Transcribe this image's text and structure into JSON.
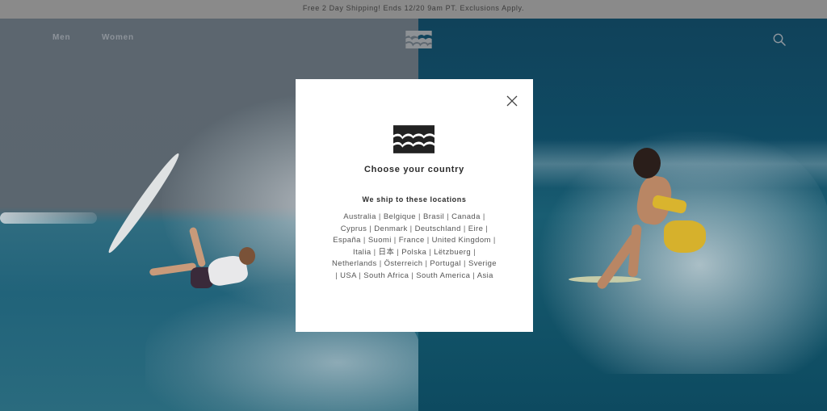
{
  "promo_bar": {
    "text": "Free 2 Day Shipping! Ends 12/20 9am PT. Exclusions Apply."
  },
  "header": {
    "nav": [
      {
        "label": "Men"
      },
      {
        "label": "Women"
      }
    ],
    "logo_icon": "billabong-wave-logo",
    "search_icon": "search-icon"
  },
  "hero": {
    "left_image": "male surfer carving wave with spray",
    "right_image": "female surfer in yellow bikini riding wave"
  },
  "modal": {
    "close_icon": "close-icon",
    "logo_icon": "billabong-wave-logo",
    "title": "Choose your country",
    "subtitle": "We ship to these locations",
    "countries": [
      "Australia",
      "Belgique",
      "Brasil",
      "Canada",
      "Cyprus",
      "Denmark",
      "Deutschland",
      "Eire",
      "España",
      "Suomi",
      "France",
      "United Kingdom",
      "Italia",
      "日本",
      "Polska",
      "Lëtzbuerg",
      "Netherlands",
      "Österreich",
      "Portugal",
      "Sverige",
      "USA",
      "South Africa",
      "South America",
      "Asia"
    ],
    "separator": "|"
  },
  "colors": {
    "promo_bg": "#8a8a8a",
    "modal_bg": "#ffffff",
    "text_dark": "#2b2b2b",
    "text_muted": "#555555"
  }
}
